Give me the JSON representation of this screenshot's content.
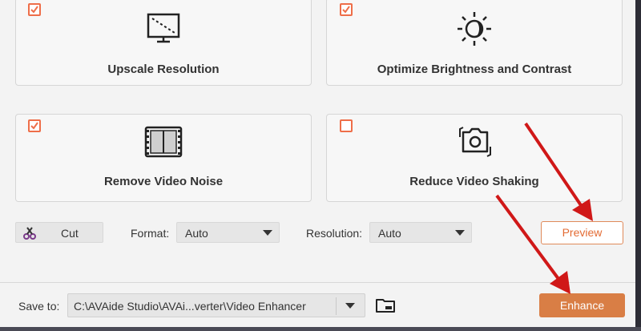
{
  "cards": [
    {
      "label": "Upscale Resolution",
      "checked": true,
      "icon": "monitor-slash-icon"
    },
    {
      "label": "Optimize Brightness and Contrast",
      "checked": true,
      "icon": "brightness-icon"
    },
    {
      "label": "Remove Video Noise",
      "checked": true,
      "icon": "film-noise-icon"
    },
    {
      "label": "Reduce Video Shaking",
      "checked": false,
      "icon": "camera-stabilize-icon"
    }
  ],
  "toolbar": {
    "cut_label": "Cut",
    "format_label": "Format:",
    "format_value": "Auto",
    "resolution_label": "Resolution:",
    "resolution_value": "Auto",
    "preview_label": "Preview"
  },
  "footer": {
    "save_label": "Save to:",
    "save_path": "C:\\AVAide Studio\\AVAi...verter\\Video Enhancer",
    "enhance_label": "Enhance"
  },
  "colors": {
    "accent": "#ee6e49",
    "enhance_bg": "#d97e45",
    "arrow": "#e31b1b"
  }
}
